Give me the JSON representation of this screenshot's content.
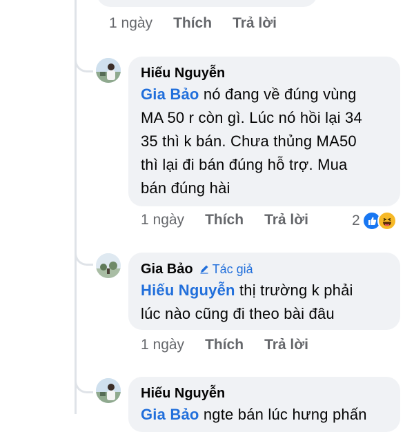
{
  "top_actions": {
    "time": "1 ngày",
    "like": "Thích",
    "reply": "Trả lời"
  },
  "comments": [
    {
      "author": "Hiếu Nguyễn",
      "mention": "Gia Bảo",
      "lines": [
        " nó đang về đúng vùng",
        "MA 50 r còn gì. Lúc nó hồi lại 34",
        "35 thì k bán. Chưa thủng MA50",
        "thì lại đi bán đúng hỗ trợ. Mua",
        "bán đúng hài"
      ],
      "time": "1 ngày",
      "like": "Thích",
      "reply": "Trả lời",
      "reaction_count": "2"
    },
    {
      "author": "Gia Bảo",
      "badge": "Tác giả",
      "mention": "Hiếu Nguyễn",
      "lines": [
        " thị trường k phải",
        "lúc nào cũng đi theo bài đâu"
      ],
      "time": "1 ngày",
      "like": "Thích",
      "reply": "Trả lời"
    },
    {
      "author": "Hiếu Nguyễn",
      "mention": "Gia Bảo",
      "lines": [
        " ngte bán lúc hưng phấn"
      ]
    }
  ],
  "colors": {
    "mention": "#216fdb",
    "bubble": "#f0f2f5",
    "meta": "#65676b",
    "like": "#1877f2",
    "haha": "#f7b928"
  },
  "icons": [
    "pencil-icon",
    "like-reaction-icon",
    "haha-reaction-icon"
  ]
}
